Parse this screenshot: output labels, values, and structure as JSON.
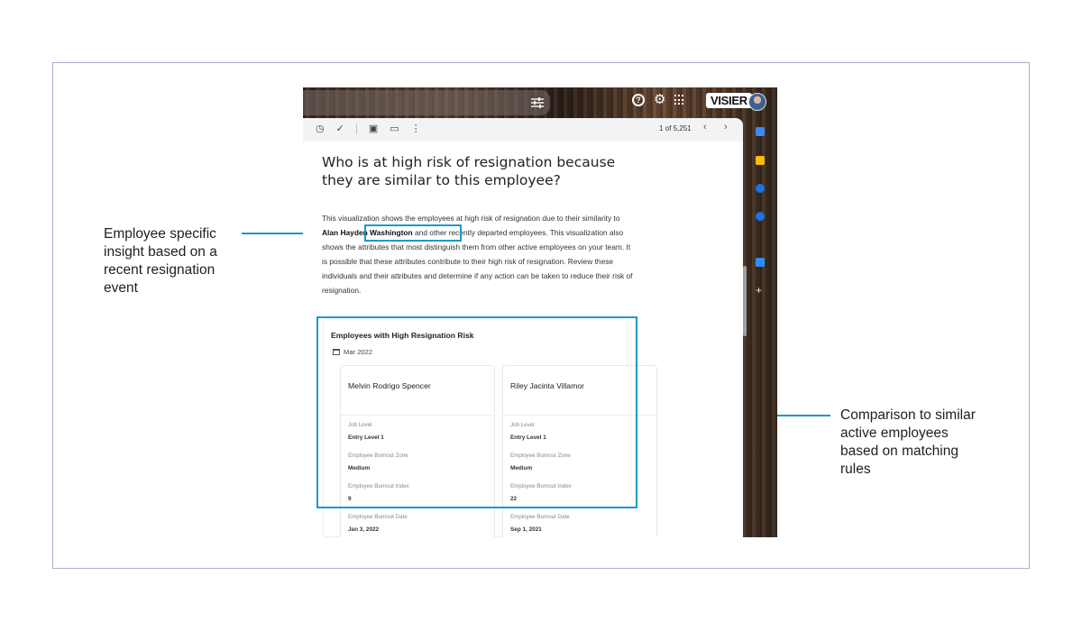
{
  "annotations": {
    "left": "Employee specific insight based on a recent resignation event",
    "right": "Comparison to similar active employees based on matching rules"
  },
  "topbar": {
    "brand": "VISIER",
    "help_glyph": "?",
    "gear_glyph": "⚙"
  },
  "mailbar": {
    "counter": "1 of 5,251",
    "prev_glyph": "‹",
    "next_glyph": "›"
  },
  "message": {
    "heading": "Who is at high risk of resignation because they are similar to this employee?",
    "para_part1": "This visualization shows the employees at high risk of resignation due to their similarity to ",
    "employee_name": "Alan Hayden Washington",
    "para_part2": " and other recently departed employees. This visualization also shows the attributes that most distinguish them from other active employees on your team. It is possible that these attributes contribute to their high risk of resignation. Review these individuals and their attributes and determine if any action can be taken to reduce their risk of resignation."
  },
  "card": {
    "title": "Employees with High Resignation Risk",
    "date": "Mar 2022",
    "employees": [
      {
        "name": "Melvin Rodrigo Spencer",
        "attrs": [
          {
            "label": "Job Level",
            "value": "Entry Level 1"
          },
          {
            "label": "Employee Burnout Zone",
            "value": "Medium"
          },
          {
            "label": "Employee Burnout Index",
            "value": "9"
          },
          {
            "label": "Employee Burnout Date",
            "value": "Jan 3, 2022"
          }
        ]
      },
      {
        "name": "Riley Jacinta Villamor",
        "attrs": [
          {
            "label": "Job Level",
            "value": "Entry Level 1"
          },
          {
            "label": "Employee Burnout Zone",
            "value": "Medium"
          },
          {
            "label": "Employee Burnout Index",
            "value": "22"
          },
          {
            "label": "Employee Burnout Date",
            "value": "Sep 1, 2021"
          }
        ]
      }
    ]
  },
  "colors": {
    "highlight": "#1e98c9",
    "frame_border": "#a9b1cc"
  },
  "side_icons": [
    {
      "name": "calendar-icon",
      "color": "#4285f4"
    },
    {
      "name": "keep-icon",
      "color": "#fbbc04"
    },
    {
      "name": "tasks-icon",
      "color": "#1a73e8"
    },
    {
      "name": "contacts-icon",
      "color": "#1a73e8"
    },
    {
      "name": "zoom-icon",
      "color": "#2d8cff"
    },
    {
      "name": "add-icon",
      "color": "#e8eaed"
    }
  ]
}
